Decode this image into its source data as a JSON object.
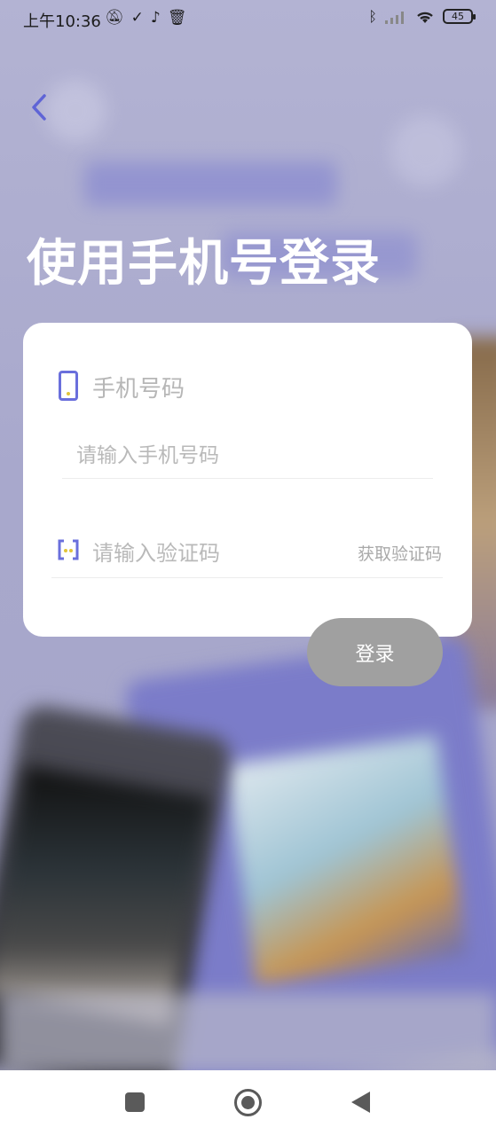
{
  "status_bar": {
    "time": "上午10:36",
    "icons": [
      "mute-icon",
      "check-icon",
      "tiktok-icon",
      "trash-icon"
    ],
    "right_icons": [
      "bluetooth-icon",
      "signal-icon",
      "wifi-icon"
    ],
    "battery": "45"
  },
  "header": {
    "back_icon": "chevron-left-icon",
    "title": "使用手机号登录"
  },
  "form": {
    "phone_label": "手机号码",
    "phone_placeholder": "请输入手机号码",
    "code_placeholder": "请输入验证码",
    "get_code_label": "获取验证码",
    "login_label": "登录"
  },
  "colors": {
    "accent": "#6a6fdc",
    "login_button": "#a0a0a0",
    "background": "#a9a9cc"
  },
  "nav": [
    "recents-icon",
    "home-icon",
    "back-icon"
  ]
}
